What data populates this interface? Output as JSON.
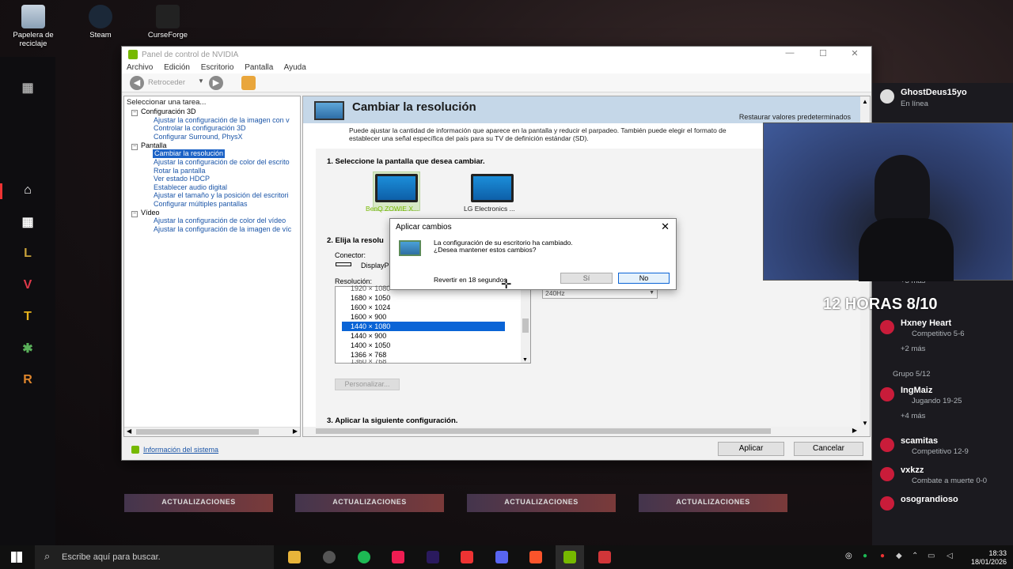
{
  "desktop": {
    "icons": [
      {
        "label": "Papelera de reciclaje",
        "icon": "recycle-bin-icon"
      },
      {
        "label": "Steam",
        "icon": "steam-icon"
      },
      {
        "label": "CurseForge",
        "icon": "curseforge-icon"
      }
    ]
  },
  "window": {
    "title": "Panel de control de NVIDIA",
    "menu": [
      "Archivo",
      "Edición",
      "Escritorio",
      "Pantalla",
      "Ayuda"
    ],
    "toolbar": {
      "back_label": "Retroceder"
    },
    "task_header": "Seleccionar una tarea...",
    "tree": {
      "cat_3d": "Configuración 3D",
      "link_3d_1": "Ajustar la configuración de la imagen con v",
      "link_3d_2": "Controlar la configuración 3D",
      "link_3d_3": "Configurar Surround, PhysX",
      "cat_display": "Pantalla",
      "link_disp_1": "Cambiar la resolución",
      "link_disp_2": "Ajustar la configuración de color del escrito",
      "link_disp_3": "Rotar la pantalla",
      "link_disp_4": "Ver estado HDCP",
      "link_disp_5": "Establecer audio digital",
      "link_disp_6": "Ajustar el tamaño y la posición del escritori",
      "link_disp_7": "Configurar múltiples pantallas",
      "cat_video": "Vídeo",
      "link_vid_1": "Ajustar la configuración de color del vídeo",
      "link_vid_2": "Ajustar la configuración de la imagen de víc"
    },
    "main": {
      "heading": "Cambiar la resolución",
      "restore_defaults": "Restaurar valores predeterminados",
      "description_1": "Puede ajustar la cantidad de información que aparece en la pantalla y reducir el parpadeo. También puede elegir el formato de",
      "description_2": "establecer una señal específica del país para su TV de definición estándar (SD).",
      "step1": "1. Seleccione la pantalla que desea cambiar.",
      "display_1": "BenQ ZOWIE X...",
      "display_2": "LG Electronics ...",
      "step2": "2. Elija la resolu",
      "connector_label": "Conector:",
      "connector_value": "DisplayP",
      "resolution_label": "Resolución:",
      "resolutions": [
        "1920 × 1080",
        "1680 × 1050",
        "1600 × 1024",
        "1600 × 900",
        "1440 × 1080",
        "1440 × 900",
        "1400 × 1050",
        "1366 × 768",
        "1360 × 768"
      ],
      "selected_resolution": "1440 × 1080",
      "refresh_value": "240Hz",
      "customize_button": "Personalizar...",
      "step3": "3. Aplicar la siguiente configuración."
    },
    "footer": {
      "system_info": "Información del sistema",
      "apply": "Aplicar",
      "cancel": "Cancelar"
    }
  },
  "dialog": {
    "title": "Aplicar cambios",
    "message_1": "La configuración de su escritorio ha cambiado.",
    "message_2": "¿Desea mantener estos cambios?",
    "countdown": "Revertir en 18 segundos",
    "yes": "Sí",
    "no": "No"
  },
  "social": {
    "friends": [
      {
        "name": "GhostDeus15yo",
        "status": "En línea"
      },
      {
        "name": "Hxney Heart",
        "status": "Competitivo 5-6"
      },
      {
        "name": "IngMaiz",
        "status": "Jugando 19-25"
      },
      {
        "name": "scamitas",
        "status": "Competitivo 12-9"
      },
      {
        "name": "vxkzz",
        "status": "Combate a muerte 0-0"
      },
      {
        "name": "osograndioso",
        "status": ""
      }
    ],
    "more_1": "+3 más",
    "more_2": "+2 más",
    "more_3": "+4 más",
    "group_label": "Grupo 5/12"
  },
  "overlay_text": "12 HORAS 8/10",
  "banners": [
    "ACTUALIZACIONES",
    "ACTUALIZACIONES",
    "ACTUALIZACIONES",
    "ACTUALIZACIONES"
  ],
  "taskbar": {
    "search_placeholder": "Escribe aquí para buscar.",
    "time": "18:33",
    "date": "18/01/2026"
  },
  "colors": {
    "nvidia_green": "#76b900",
    "selection_blue": "#0a64d6",
    "accent_red": "#c91c3a"
  }
}
